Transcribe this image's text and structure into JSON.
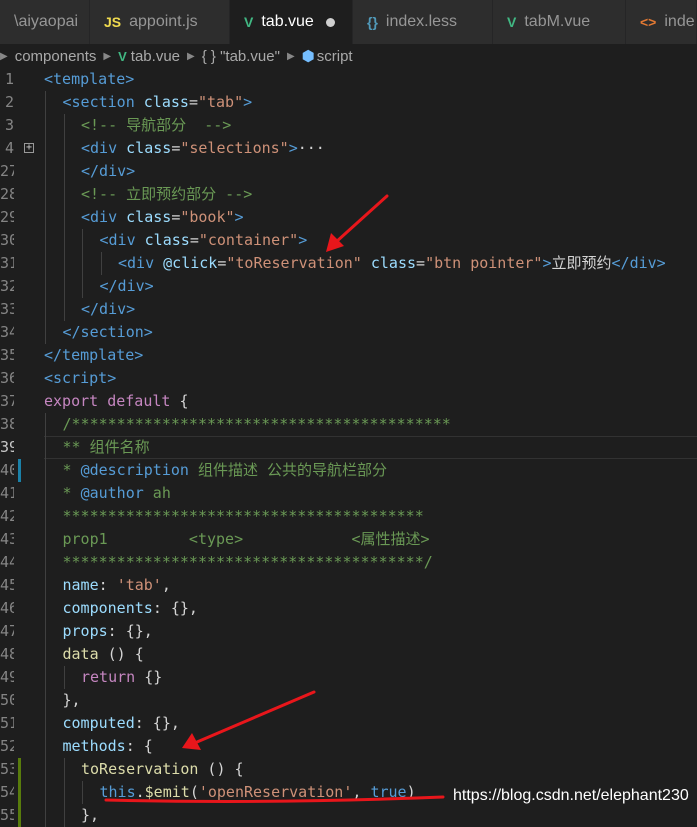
{
  "tabs": [
    {
      "label": "\\aiyaopai",
      "icon": "",
      "icon_color": "",
      "active": false,
      "dirty": false
    },
    {
      "label": "appoint.js",
      "icon": "JS",
      "icon_color": "#f0db4f",
      "active": false,
      "dirty": false
    },
    {
      "label": "tab.vue",
      "icon": "V",
      "icon_color": "#41b883",
      "active": true,
      "dirty": true
    },
    {
      "label": "index.less",
      "icon": "{}",
      "icon_color": "#519aba",
      "active": false,
      "dirty": false
    },
    {
      "label": "tabM.vue",
      "icon": "V",
      "icon_color": "#41b883",
      "active": false,
      "dirty": false
    },
    {
      "label": "inde",
      "icon": "<>",
      "icon_color": "#e37933",
      "active": false,
      "dirty": false
    }
  ],
  "breadcrumb": {
    "folder": "components",
    "file": "tab.vue",
    "object": "{ } \"tab.vue\"",
    "symbol": "script"
  },
  "current_line": "39",
  "lines": [
    {
      "n": "1",
      "indent": 0,
      "tokens": [
        [
          "tag",
          "<template>"
        ]
      ]
    },
    {
      "n": "2",
      "indent": 1,
      "tokens": [
        [
          "tag",
          "<section "
        ],
        [
          "attr",
          "class"
        ],
        [
          "txt",
          "="
        ],
        [
          "str",
          "\"tab\""
        ],
        [
          "tag",
          ">"
        ]
      ]
    },
    {
      "n": "3",
      "indent": 2,
      "tokens": [
        [
          "com",
          "<!-- 导航部分  -->"
        ]
      ]
    },
    {
      "n": "4",
      "indent": 2,
      "fold": true,
      "tokens": [
        [
          "tag",
          "<div "
        ],
        [
          "attr",
          "class"
        ],
        [
          "txt",
          "="
        ],
        [
          "str",
          "\"selections\""
        ],
        [
          "tag",
          ">"
        ],
        [
          "txt",
          "···"
        ]
      ]
    },
    {
      "n": "27",
      "indent": 2,
      "tokens": [
        [
          "tag",
          "</div>"
        ]
      ]
    },
    {
      "n": "28",
      "indent": 2,
      "tokens": [
        [
          "com",
          "<!-- 立即预约部分 -->"
        ]
      ]
    },
    {
      "n": "29",
      "indent": 2,
      "tokens": [
        [
          "tag",
          "<div "
        ],
        [
          "attr",
          "class"
        ],
        [
          "txt",
          "="
        ],
        [
          "str",
          "\"book\""
        ],
        [
          "tag",
          ">"
        ]
      ]
    },
    {
      "n": "30",
      "indent": 3,
      "tokens": [
        [
          "tag",
          "<div "
        ],
        [
          "attr",
          "class"
        ],
        [
          "txt",
          "="
        ],
        [
          "str",
          "\"container\""
        ],
        [
          "tag",
          ">"
        ]
      ]
    },
    {
      "n": "31",
      "indent": 4,
      "tokens": [
        [
          "tag",
          "<div "
        ],
        [
          "attr",
          "@click"
        ],
        [
          "txt",
          "="
        ],
        [
          "str",
          "\"toReservation\""
        ],
        [
          "txt",
          " "
        ],
        [
          "attr",
          "class"
        ],
        [
          "txt",
          "="
        ],
        [
          "str",
          "\"btn pointer\""
        ],
        [
          "tag",
          ">"
        ],
        [
          "txt",
          "立即预约"
        ],
        [
          "tag",
          "</div>"
        ]
      ]
    },
    {
      "n": "32",
      "indent": 3,
      "tokens": [
        [
          "tag",
          "</div>"
        ]
      ]
    },
    {
      "n": "33",
      "indent": 2,
      "tokens": [
        [
          "tag",
          "</div>"
        ]
      ]
    },
    {
      "n": "34",
      "indent": 1,
      "tokens": [
        [
          "tag",
          "</section>"
        ]
      ]
    },
    {
      "n": "35",
      "indent": 0,
      "tokens": [
        [
          "tag",
          "</template>"
        ]
      ]
    },
    {
      "n": "36",
      "indent": 0,
      "tokens": [
        [
          "tag",
          "<script>"
        ]
      ]
    },
    {
      "n": "37",
      "indent": 0,
      "tokens": [
        [
          "ctrl",
          "export"
        ],
        [
          "txt",
          " "
        ],
        [
          "ctrl",
          "default"
        ],
        [
          "txt",
          " {"
        ]
      ]
    },
    {
      "n": "38",
      "indent": 1,
      "tokens": [
        [
          "com",
          "/******************************************"
        ]
      ]
    },
    {
      "n": "39",
      "indent": 1,
      "tokens": [
        [
          "com",
          "** 组件名称"
        ]
      ]
    },
    {
      "n": "40",
      "indent": 1,
      "tokens": [
        [
          "com",
          "* "
        ],
        [
          "jd",
          "@description"
        ],
        [
          "com",
          " 组件描述 公共的导航栏部分"
        ]
      ]
    },
    {
      "n": "41",
      "indent": 1,
      "tokens": [
        [
          "com",
          "* "
        ],
        [
          "jd",
          "@author"
        ],
        [
          "com",
          " ah"
        ]
      ]
    },
    {
      "n": "42",
      "indent": 1,
      "tokens": [
        [
          "com",
          "****************************************"
        ]
      ]
    },
    {
      "n": "43",
      "indent": 1,
      "tokens": [
        [
          "com",
          "prop1         <type>            <属性描述>"
        ]
      ]
    },
    {
      "n": "44",
      "indent": 1,
      "tokens": [
        [
          "com",
          "****************************************/"
        ]
      ]
    },
    {
      "n": "45",
      "indent": 1,
      "tokens": [
        [
          "prop",
          "name"
        ],
        [
          "txt",
          ": "
        ],
        [
          "str",
          "'tab'"
        ],
        [
          "txt",
          ","
        ]
      ]
    },
    {
      "n": "46",
      "indent": 1,
      "tokens": [
        [
          "prop",
          "components"
        ],
        [
          "txt",
          ": {},"
        ]
      ]
    },
    {
      "n": "47",
      "indent": 1,
      "tokens": [
        [
          "prop",
          "props"
        ],
        [
          "txt",
          ": {},"
        ]
      ]
    },
    {
      "n": "48",
      "indent": 1,
      "tokens": [
        [
          "fn",
          "data"
        ],
        [
          "txt",
          " () {"
        ]
      ]
    },
    {
      "n": "49",
      "indent": 2,
      "tokens": [
        [
          "ctrl",
          "return"
        ],
        [
          "txt",
          " {}"
        ]
      ]
    },
    {
      "n": "50",
      "indent": 1,
      "tokens": [
        [
          "txt",
          "},"
        ]
      ]
    },
    {
      "n": "51",
      "indent": 1,
      "tokens": [
        [
          "prop",
          "computed"
        ],
        [
          "txt",
          ": {},"
        ]
      ]
    },
    {
      "n": "52",
      "indent": 1,
      "tokens": [
        [
          "prop",
          "methods"
        ],
        [
          "txt",
          ": {"
        ]
      ]
    },
    {
      "n": "53",
      "indent": 2,
      "tokens": [
        [
          "fn",
          "toReservation"
        ],
        [
          "txt",
          " () {"
        ]
      ]
    },
    {
      "n": "54",
      "indent": 3,
      "tokens": [
        [
          "kw",
          "this"
        ],
        [
          "txt",
          "."
        ],
        [
          "fn",
          "$emit"
        ],
        [
          "txt",
          "("
        ],
        [
          "str",
          "'openReservation'"
        ],
        [
          "txt",
          ", "
        ],
        [
          "kw",
          "true"
        ],
        [
          "txt",
          ")"
        ]
      ]
    },
    {
      "n": "55",
      "indent": 2,
      "tokens": [
        [
          "txt",
          "},"
        ]
      ]
    }
  ],
  "gutter_marks": [
    {
      "n": "40",
      "color": "#1b81a8"
    },
    {
      "n": "53",
      "color": "#587c0c"
    },
    {
      "n": "54",
      "color": "#587c0c"
    },
    {
      "n": "55",
      "color": "#587c0c"
    }
  ],
  "watermark": "https://blog.csdn.net/elephant230",
  "annotation_color": "#e8161b"
}
